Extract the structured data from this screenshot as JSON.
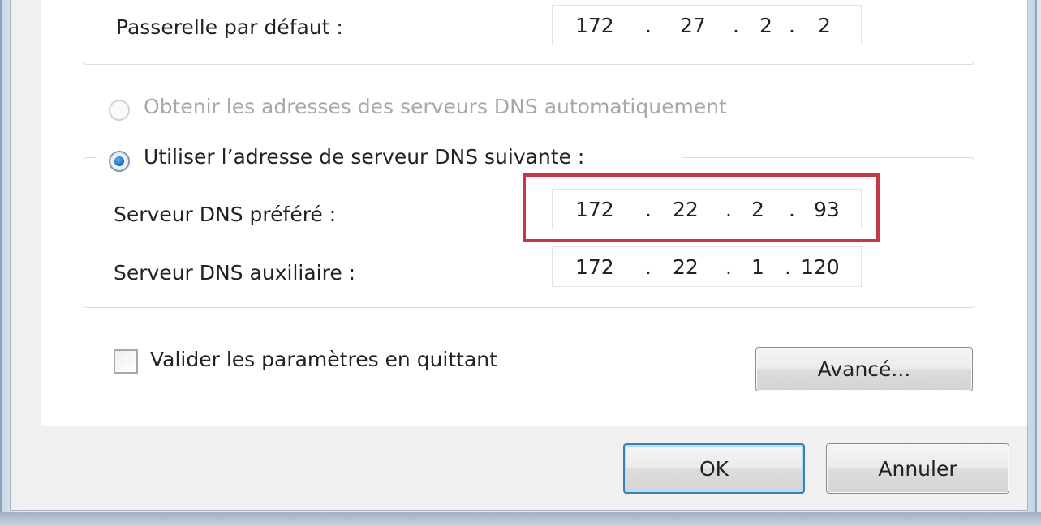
{
  "gateway": {
    "label": "Passerelle par défaut :",
    "octets": [
      "172",
      "27",
      "2",
      "2"
    ]
  },
  "dns": {
    "auto_option": "Obtenir les adresses des serveurs DNS automatiquement",
    "manual_option": "Utiliser l’adresse de serveur DNS suivante :",
    "selected_option": "manual",
    "preferred": {
      "label": "Serveur DNS préféré :",
      "octets": [
        "172",
        "22",
        "2",
        "93"
      ]
    },
    "alternate": {
      "label": "Serveur DNS auxiliaire :",
      "octets": [
        "172",
        "22",
        "1",
        "120"
      ]
    }
  },
  "validate": {
    "label": "Valider les paramètres en quittant",
    "checked": false
  },
  "buttons": {
    "advanced": "Avancé...",
    "ok": "OK",
    "cancel": "Annuler"
  },
  "colors": {
    "highlight_box": "#c23a48",
    "default_button_border": "#3c7fb1"
  }
}
